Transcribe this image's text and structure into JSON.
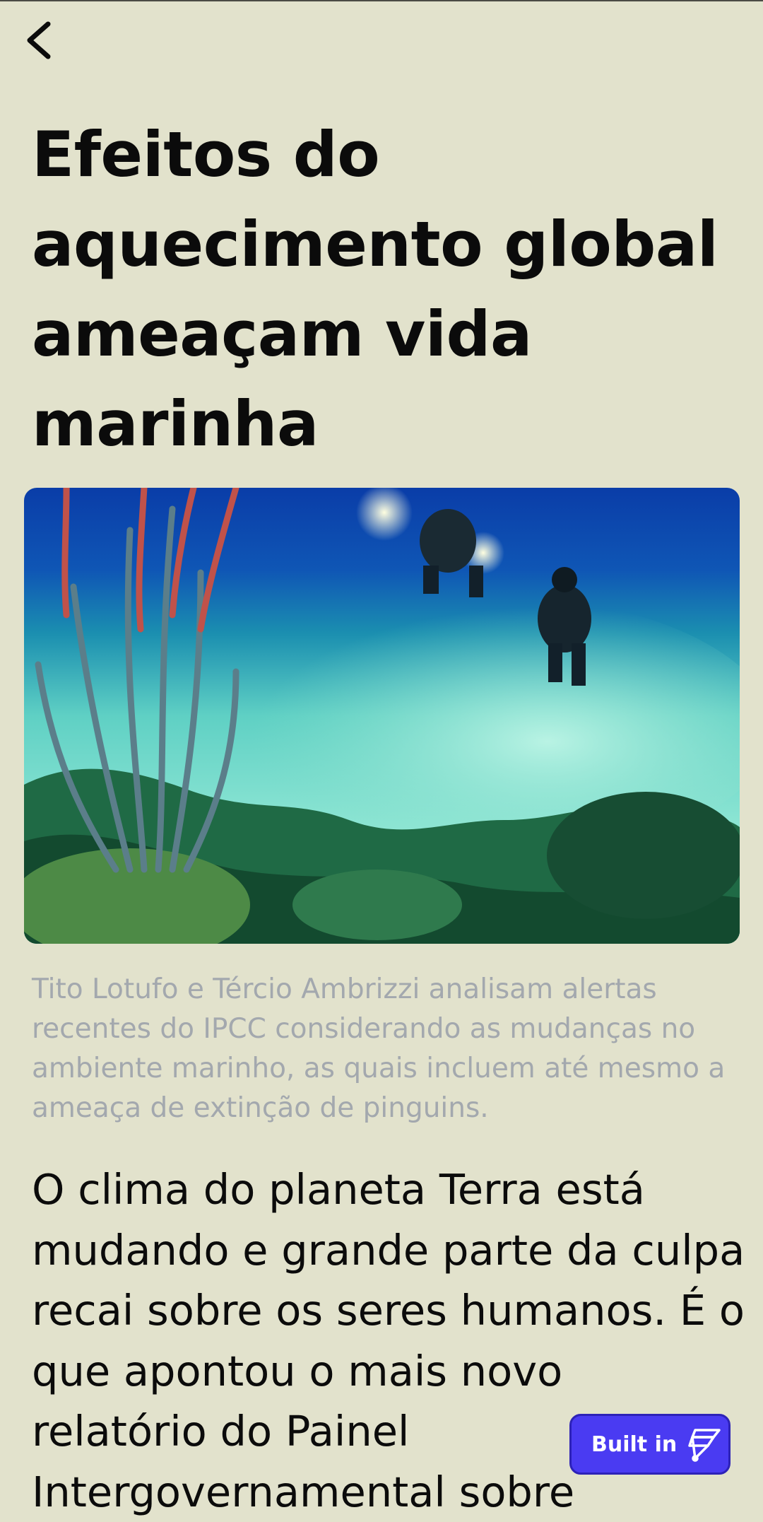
{
  "article": {
    "title": "Efeitos do aquecimento global ameaçam vida marinha",
    "caption": "Tito Lotufo e Tércio Ambrizzi analisam alertas recentes do IPCC considerando as mudanças no ambiente marinho, as quais incluem até mesmo a ameaça de extinção de pinguins.",
    "body": "O clima do planeta Terra está mudando e grande parte da culpa recai sobre os seres humanos. É o que apontou o mais novo relatório do Painel Intergovernamental sobre"
  },
  "badge": {
    "label": "Built in",
    "icon": "builder-logo-icon"
  },
  "icons": {
    "back": "chevron-left-icon"
  },
  "colors": {
    "background": "#e2e2cc",
    "text": "#0b0b0b",
    "caption": "#a3a8ae",
    "badge": "#4a3bf2"
  }
}
